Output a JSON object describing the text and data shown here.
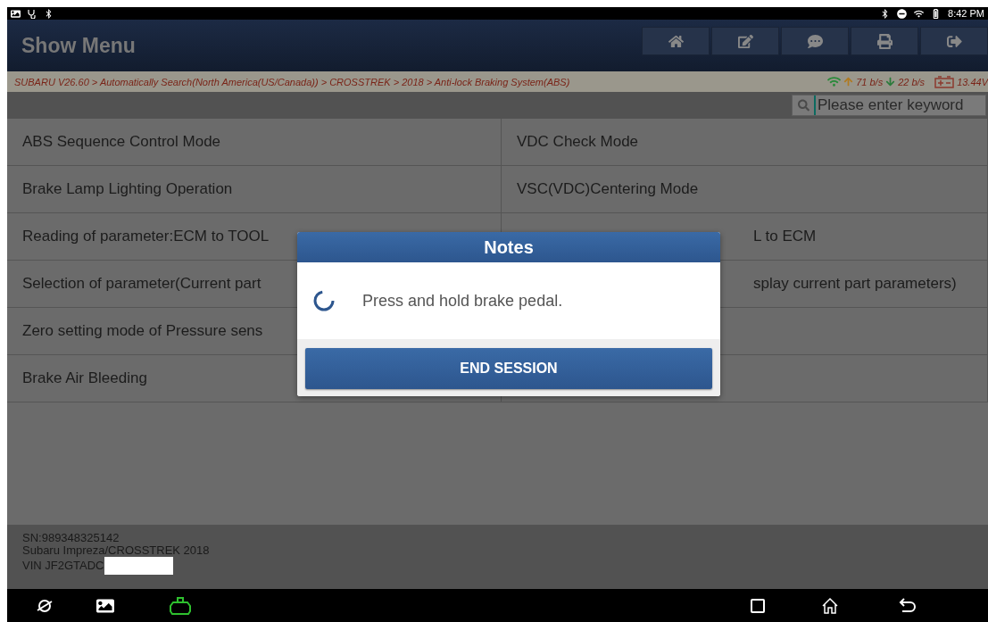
{
  "status_bar": {
    "time": "8:42 PM"
  },
  "header": {
    "title": "Show Menu"
  },
  "breadcrumb": {
    "path": "SUBARU V26.60 > Automatically Search(North America(US/Canada)) > CROSSTREK > 2018 > Anti-lock Braking System(ABS)",
    "upload": "71 b/s",
    "download": "22 b/s",
    "voltage": "13.44V"
  },
  "search": {
    "placeholder": "Please enter keyword"
  },
  "menu_rows": [
    {
      "left": {
        "label": "ABS Sequence Control Mode",
        "hidden_start": false
      },
      "right": {
        "label": "VDC Check Mode",
        "hidden_start": false
      }
    },
    {
      "left": {
        "label": "Brake Lamp Lighting Operation",
        "hidden_start": false
      },
      "right": {
        "label": "VSC(VDC)Centering Mode",
        "hidden_start": false
      }
    },
    {
      "left": {
        "label": "Reading of parameter:ECM to TOOL",
        "hidden_start": false
      },
      "right": {
        "label": "L to ECM",
        "hidden_start": true
      }
    },
    {
      "left": {
        "label": "Selection of parameter(Current part",
        "hidden_start": false
      },
      "right": {
        "label": "splay current part parameters)",
        "hidden_start": true
      }
    },
    {
      "left": {
        "label": "Zero setting mode of Pressure sens",
        "hidden_start": false
      },
      "right": {}
    },
    {
      "left": {
        "label": "Brake Air Bleeding",
        "hidden_start": false
      },
      "right": {}
    }
  ],
  "footer": {
    "lines": [
      "SN:989348325142",
      "Subaru Impreza/CROSSTREK 2018",
      "VIN JF2GTADC"
    ]
  },
  "dialog": {
    "title": "Notes",
    "message": "Press and hold brake pedal.",
    "button": "END SESSION"
  }
}
